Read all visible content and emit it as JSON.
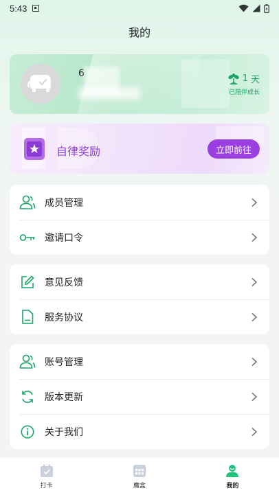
{
  "status": {
    "time": "5:43"
  },
  "header": {
    "title": "我的"
  },
  "profile": {
    "name_visible": "6",
    "days_count": "1",
    "days_unit": "天",
    "days_label": "已陪伴成长"
  },
  "reward": {
    "title": "自律奖励",
    "button_label": "立即前往"
  },
  "menu_groups": [
    {
      "items": [
        {
          "label": "成员管理",
          "icon": "members-icon"
        },
        {
          "label": "邀请口令",
          "icon": "key-icon"
        }
      ]
    },
    {
      "items": [
        {
          "label": "意见反馈",
          "icon": "feedback-icon"
        },
        {
          "label": "服务协议",
          "icon": "document-icon"
        }
      ]
    },
    {
      "items": [
        {
          "label": "账号管理",
          "icon": "account-icon"
        },
        {
          "label": "版本更新",
          "icon": "refresh-icon"
        },
        {
          "label": "关于我们",
          "icon": "info-icon"
        }
      ]
    }
  ],
  "tabs": [
    {
      "label": "打卡",
      "icon": "checkin-icon",
      "active": false
    },
    {
      "label": "魔盒",
      "icon": "box-icon",
      "active": false
    },
    {
      "label": "我的",
      "icon": "profile-icon",
      "active": true
    }
  ],
  "colors": {
    "accent_green": "#1aa36a",
    "accent_purple": "#9b3fe0",
    "active_tab": "#22c07a",
    "inactive_tab": "#c8d0de"
  }
}
